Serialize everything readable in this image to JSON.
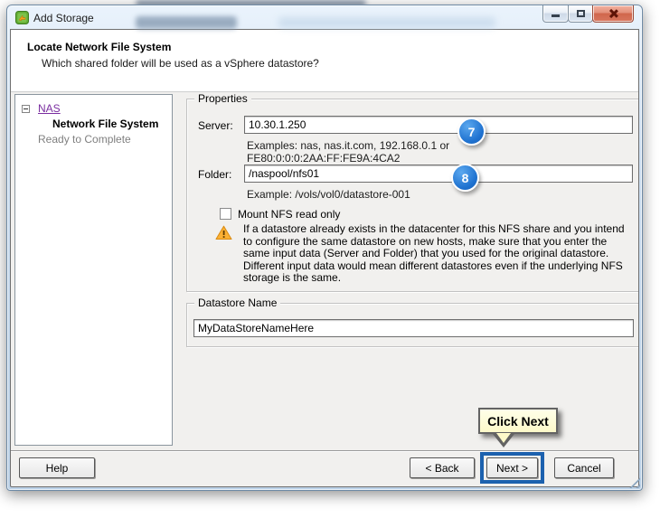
{
  "window": {
    "title": "Add Storage"
  },
  "header": {
    "title": "Locate Network File System",
    "subtitle": "Which shared folder will be used as a vSphere datastore?"
  },
  "sidebar": {
    "items": [
      {
        "label": "NAS"
      },
      {
        "label": "Network File System"
      },
      {
        "label": "Ready to Complete"
      }
    ]
  },
  "properties": {
    "legend": "Properties",
    "server_label": "Server:",
    "server_value": "10.30.1.250",
    "server_hint1": "Examples: nas, nas.it.com, 192.168.0.1 or",
    "server_hint2": "FE80:0:0:0:2AA:FF:FE9A:4CA2",
    "folder_label": "Folder:",
    "folder_value": "/naspool/nfs01",
    "folder_hint": "Example: /vols/vol0/datastore-001",
    "mount_label": "Mount NFS read only",
    "warning_text": "If a datastore already exists in the datacenter for this NFS share and you intend to configure the same datastore on new hosts, make sure that you enter the same input data (Server and Folder) that you used for the original datastore. Different input data would mean different datastores even if the underlying NFS storage is the same."
  },
  "datastore": {
    "legend": "Datastore Name",
    "value": "MyDataStoreNameHere"
  },
  "annotations": {
    "callout_7": "7",
    "callout_8": "8",
    "tooltip_text": "Click Next",
    "circle_color": "#1f72d0",
    "highlight_color": "#1c61ae",
    "tooltip_bg": "#fdf9c9",
    "warning_color": "#f5a11c"
  },
  "footer": {
    "help": "Help",
    "back": "< Back",
    "next": "Next >",
    "cancel": "Cancel"
  }
}
